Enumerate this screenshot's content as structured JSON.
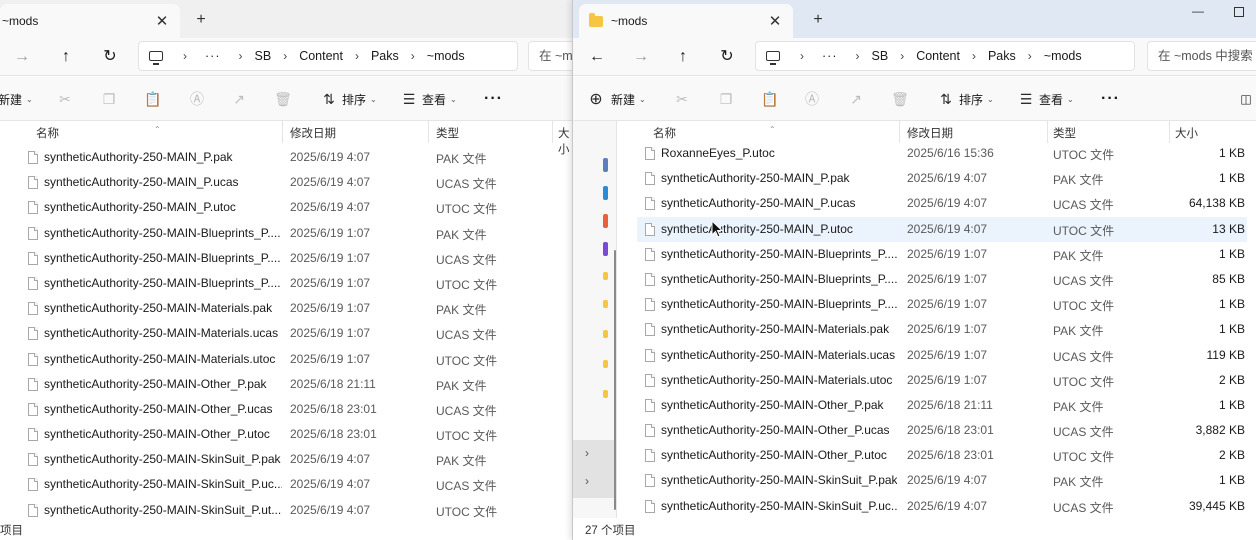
{
  "left": {
    "tab_title": "~mods",
    "tab_close": "✕",
    "new_tab": "+",
    "breadcrumb": [
      "SB",
      "Content",
      "Paks",
      "~mods"
    ],
    "breadcrumb_overflow": "···",
    "search_placeholder": "在 ~m",
    "toolbar": {
      "new_label": "新建",
      "sort_label": "排序",
      "view_label": "查看",
      "more": "···"
    },
    "columns": {
      "name": "名称",
      "date": "修改日期",
      "type": "类型",
      "size": "大小"
    },
    "files": [
      {
        "name": "syntheticAuthority-250-MAIN_P.pak",
        "date": "2025/6/19 4:07",
        "type": "PAK 文件"
      },
      {
        "name": "syntheticAuthority-250-MAIN_P.ucas",
        "date": "2025/6/19 4:07",
        "type": "UCAS 文件"
      },
      {
        "name": "syntheticAuthority-250-MAIN_P.utoc",
        "date": "2025/6/19 4:07",
        "type": "UTOC 文件"
      },
      {
        "name": "syntheticAuthority-250-MAIN-Blueprints_P....",
        "date": "2025/6/19 1:07",
        "type": "PAK 文件"
      },
      {
        "name": "syntheticAuthority-250-MAIN-Blueprints_P....",
        "date": "2025/6/19 1:07",
        "type": "UCAS 文件"
      },
      {
        "name": "syntheticAuthority-250-MAIN-Blueprints_P....",
        "date": "2025/6/19 1:07",
        "type": "UTOC 文件"
      },
      {
        "name": "syntheticAuthority-250-MAIN-Materials.pak",
        "date": "2025/6/19 1:07",
        "type": "PAK 文件"
      },
      {
        "name": "syntheticAuthority-250-MAIN-Materials.ucas",
        "date": "2025/6/19 1:07",
        "type": "UCAS 文件"
      },
      {
        "name": "syntheticAuthority-250-MAIN-Materials.utoc",
        "date": "2025/6/19 1:07",
        "type": "UTOC 文件"
      },
      {
        "name": "syntheticAuthority-250-MAIN-Other_P.pak",
        "date": "2025/6/18 21:11",
        "type": "PAK 文件"
      },
      {
        "name": "syntheticAuthority-250-MAIN-Other_P.ucas",
        "date": "2025/6/18 23:01",
        "type": "UCAS 文件"
      },
      {
        "name": "syntheticAuthority-250-MAIN-Other_P.utoc",
        "date": "2025/6/18 23:01",
        "type": "UTOC 文件"
      },
      {
        "name": "syntheticAuthority-250-MAIN-SkinSuit_P.pak",
        "date": "2025/6/19 4:07",
        "type": "PAK 文件"
      },
      {
        "name": "syntheticAuthority-250-MAIN-SkinSuit_P.uc...",
        "date": "2025/6/19 4:07",
        "type": "UCAS 文件"
      },
      {
        "name": "syntheticAuthority-250-MAIN-SkinSuit_P.ut...",
        "date": "2025/6/19 4:07",
        "type": "UTOC 文件"
      }
    ],
    "status": "项目"
  },
  "right": {
    "tab_title": "~mods",
    "tab_close": "✕",
    "new_tab": "+",
    "breadcrumb": [
      "SB",
      "Content",
      "Paks",
      "~mods"
    ],
    "breadcrumb_overflow": "···",
    "search_placeholder": "在 ~mods 中搜索",
    "toolbar": {
      "new_label": "新建",
      "sort_label": "排序",
      "view_label": "查看",
      "more": "···"
    },
    "columns": {
      "name": "名称",
      "date": "修改日期",
      "type": "类型",
      "size": "大小"
    },
    "files": [
      {
        "name": "RoxanneEyes_P.utoc",
        "date": "2025/6/16 15:36",
        "type": "UTOC 文件",
        "size": "1 KB"
      },
      {
        "name": "syntheticAuthority-250-MAIN_P.pak",
        "date": "2025/6/19 4:07",
        "type": "PAK 文件",
        "size": "1 KB"
      },
      {
        "name": "syntheticAuthority-250-MAIN_P.ucas",
        "date": "2025/6/19 4:07",
        "type": "UCAS 文件",
        "size": "64,138 KB"
      },
      {
        "name": "syntheticAuthority-250-MAIN_P.utoc",
        "date": "2025/6/19 4:07",
        "type": "UTOC 文件",
        "size": "13 KB"
      },
      {
        "name": "syntheticAuthority-250-MAIN-Blueprints_P....",
        "date": "2025/6/19 1:07",
        "type": "PAK 文件",
        "size": "1 KB"
      },
      {
        "name": "syntheticAuthority-250-MAIN-Blueprints_P....",
        "date": "2025/6/19 1:07",
        "type": "UCAS 文件",
        "size": "85 KB"
      },
      {
        "name": "syntheticAuthority-250-MAIN-Blueprints_P....",
        "date": "2025/6/19 1:07",
        "type": "UTOC 文件",
        "size": "1 KB"
      },
      {
        "name": "syntheticAuthority-250-MAIN-Materials.pak",
        "date": "2025/6/19 1:07",
        "type": "PAK 文件",
        "size": "1 KB"
      },
      {
        "name": "syntheticAuthority-250-MAIN-Materials.ucas",
        "date": "2025/6/19 1:07",
        "type": "UCAS 文件",
        "size": "119 KB"
      },
      {
        "name": "syntheticAuthority-250-MAIN-Materials.utoc",
        "date": "2025/6/19 1:07",
        "type": "UTOC 文件",
        "size": "2 KB"
      },
      {
        "name": "syntheticAuthority-250-MAIN-Other_P.pak",
        "date": "2025/6/18 21:11",
        "type": "PAK 文件",
        "size": "1 KB"
      },
      {
        "name": "syntheticAuthority-250-MAIN-Other_P.ucas",
        "date": "2025/6/18 23:01",
        "type": "UCAS 文件",
        "size": "3,882 KB"
      },
      {
        "name": "syntheticAuthority-250-MAIN-Other_P.utoc",
        "date": "2025/6/18 23:01",
        "type": "UTOC 文件",
        "size": "2 KB"
      },
      {
        "name": "syntheticAuthority-250-MAIN-SkinSuit_P.pak",
        "date": "2025/6/19 4:07",
        "type": "PAK 文件",
        "size": "1 KB"
      },
      {
        "name": "syntheticAuthority-250-MAIN-SkinSuit_P.uc...",
        "date": "2025/6/19 4:07",
        "type": "UCAS 文件",
        "size": "39,445 KB"
      }
    ],
    "hover_row": 3,
    "status": "27 个项目"
  },
  "colors": {
    "hover_row": "#ebf3fd",
    "active_titlebar": "#dfe8f3",
    "folder": "#f6c544"
  }
}
